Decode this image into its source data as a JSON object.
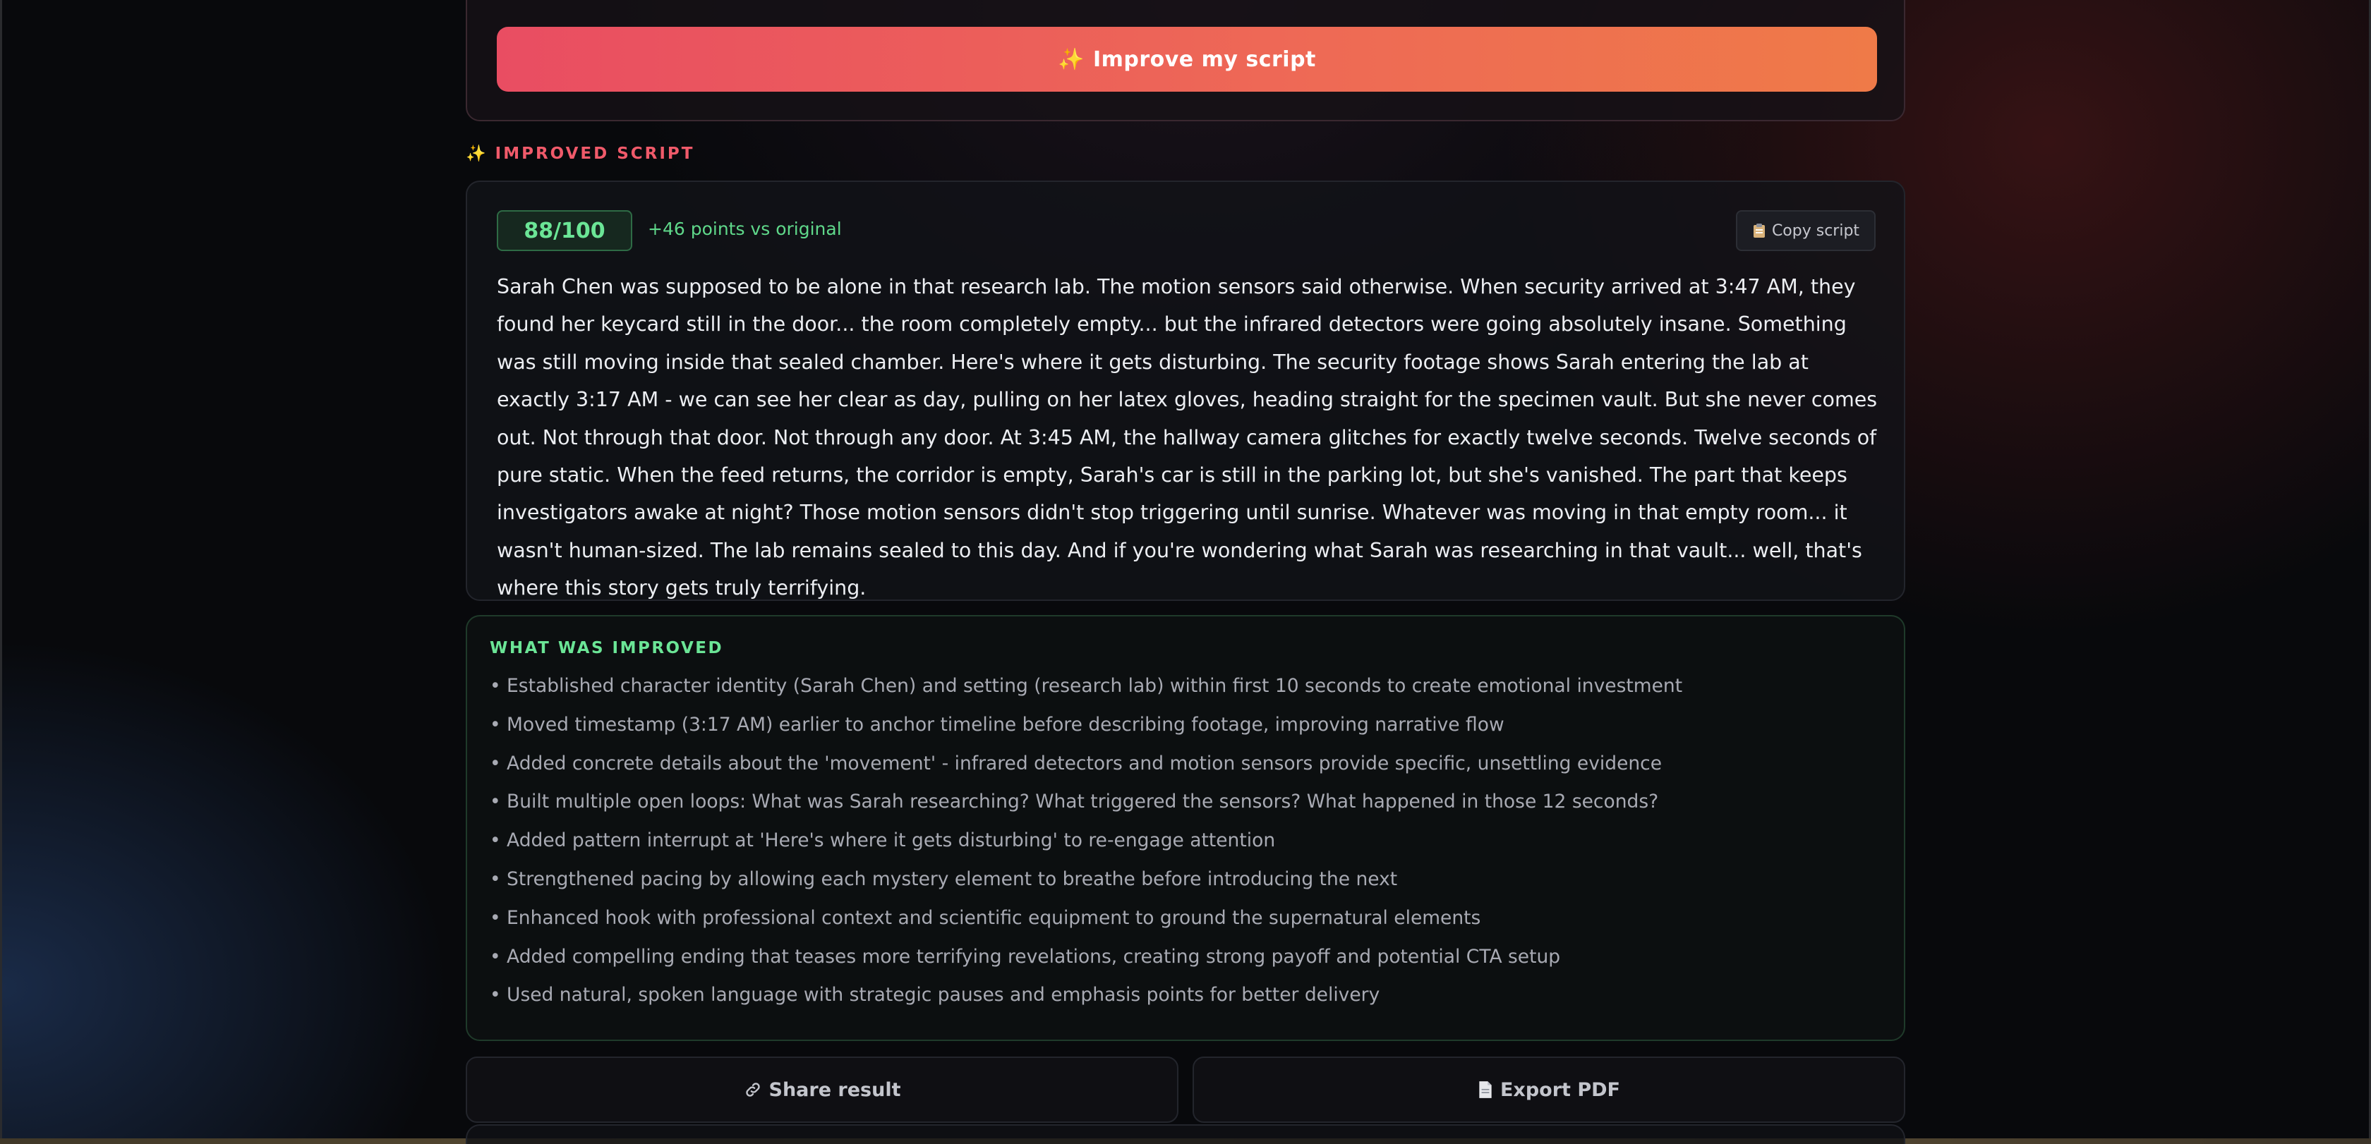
{
  "improve_button": {
    "icon": "sparkles-icon",
    "label": "Improve my script"
  },
  "section": {
    "icon": "sparkles-icon",
    "label": "IMPROVED SCRIPT"
  },
  "script_card": {
    "score": "88/100",
    "delta": "+46 points vs original",
    "copy_label": "Copy script",
    "copy_icon": "clipboard-icon",
    "text": "Sarah Chen was supposed to be alone in that research lab. The motion sensors said otherwise. When security arrived at 3:47 AM, they found her keycard still in the door... the room completely empty... but the infrared detectors were going absolutely insane. Something was still moving inside that sealed chamber. Here's where it gets disturbing. The security footage shows Sarah entering the lab at exactly 3:17 AM - we can see her clear as day, pulling on her latex gloves, heading straight for the specimen vault. But she never comes out. Not through that door. Not through any door. At 3:45 AM, the hallway camera glitches for exactly twelve seconds. Twelve seconds of pure static. When the feed returns, the corridor is empty, Sarah's car is still in the parking lot, but she's vanished. The part that keeps investigators awake at night? Those motion sensors didn't stop triggering until sunrise. Whatever was moving in that empty room... it wasn't human-sized. The lab remains sealed to this day. And if you're wondering what Sarah was researching in that vault... well, that's where this story gets truly terrifying."
  },
  "improvements": {
    "title": "WHAT WAS IMPROVED",
    "items": [
      "• Established character identity (Sarah Chen) and setting (research lab) within first 10 seconds to create emotional investment",
      "• Moved timestamp (3:17 AM) earlier to anchor timeline before describing footage, improving narrative flow",
      "• Added concrete details about the 'movement' - infrared detectors and motion sensors provide specific, unsettling evidence",
      "• Built multiple open loops: What was Sarah researching? What triggered the sensors? What happened in those 12 seconds?",
      "• Added pattern interrupt at 'Here's where it gets disturbing' to re-engage attention",
      "• Strengthened pacing by allowing each mystery element to breathe before introducing the next",
      "• Enhanced hook with professional context and scientific equipment to ground the supernatural elements",
      "• Added compelling ending that teases more terrifying revelations, creating strong payoff and potential CTA setup",
      "• Used natural, spoken language with strategic pauses and emphasis points for better delivery"
    ]
  },
  "actions": {
    "share_label": "Share result",
    "share_icon": "link-icon",
    "export_label": "Export PDF",
    "export_icon": "document-icon"
  },
  "colors": {
    "accent_gradient_start": "#e94d62",
    "accent_gradient_end": "#ef7a48",
    "section_label": "#f05a6a",
    "success": "#6be596"
  }
}
